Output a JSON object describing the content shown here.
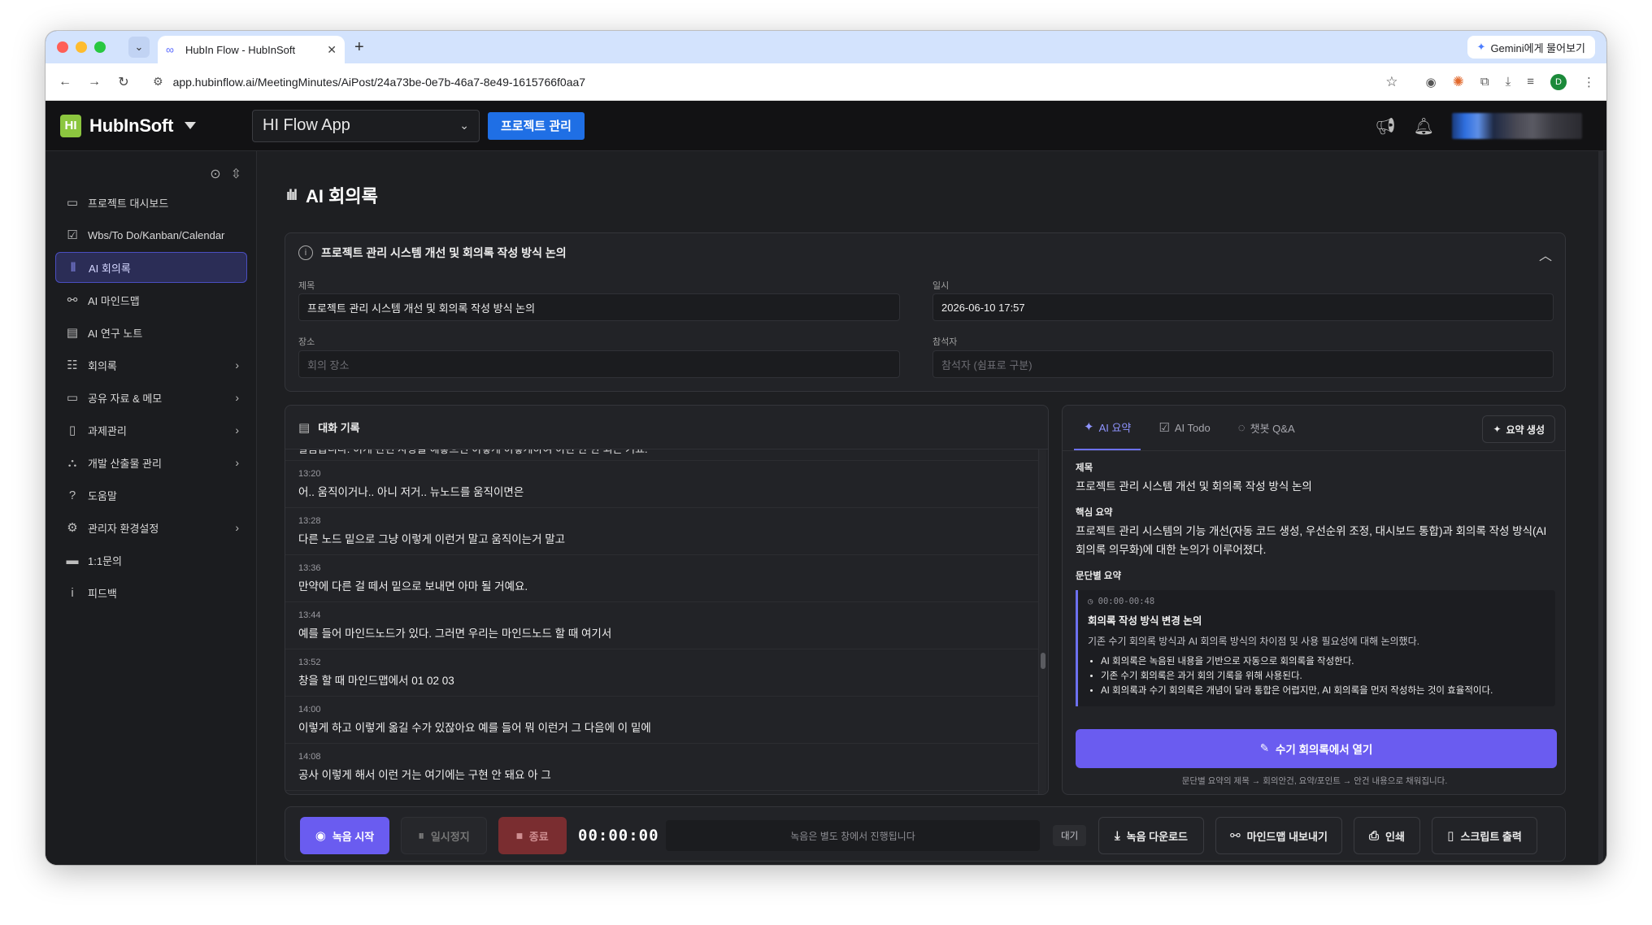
{
  "browser": {
    "tab_title": "HubIn Flow - HubInSoft",
    "gemini_label": "Gemini에게 물어보기",
    "url": "app.hubinflow.ai/MeetingMinutes/AiPost/24a73be-0e7b-46a7-8e49-1615766f0aa7",
    "profile_initial": "D"
  },
  "header": {
    "brand": "HubInSoft",
    "app_selector": "HI Flow App",
    "project_button": "프로젝트 관리"
  },
  "sidebar": {
    "items": [
      {
        "label": "프로젝트 대시보드",
        "icon": "dashboard-icon",
        "glyph": "▭",
        "has_arrow": false
      },
      {
        "label": "Wbs/To Do/Kanban/Calendar",
        "icon": "calendar-check-icon",
        "glyph": "☑",
        "has_arrow": false
      },
      {
        "label": "AI 회의록",
        "icon": "audio-wave-icon",
        "glyph": "⦀",
        "has_arrow": false,
        "active": true
      },
      {
        "label": "AI 마인드맵",
        "icon": "mindmap-icon",
        "glyph": "⚯",
        "has_arrow": false
      },
      {
        "label": "AI 연구 노트",
        "icon": "note-icon",
        "glyph": "▤",
        "has_arrow": false
      },
      {
        "label": "회의록",
        "icon": "chat-icon",
        "glyph": "☷",
        "has_arrow": true
      },
      {
        "label": "공유 자료 & 메모",
        "icon": "folder-icon",
        "glyph": "▭",
        "has_arrow": true
      },
      {
        "label": "과제관리",
        "icon": "task-icon",
        "glyph": "▯",
        "has_arrow": true
      },
      {
        "label": "개발 산출물 관리",
        "icon": "hierarchy-icon",
        "glyph": "⛬",
        "has_arrow": true
      },
      {
        "label": "도움말",
        "icon": "help-icon",
        "glyph": "?",
        "has_arrow": false
      },
      {
        "label": "관리자 환경설정",
        "icon": "admin-settings-icon",
        "glyph": "⚙",
        "has_arrow": true
      },
      {
        "label": "1:1문의",
        "icon": "message-icon",
        "glyph": "▬",
        "has_arrow": false
      },
      {
        "label": "피드백",
        "icon": "info-icon",
        "glyph": "i",
        "has_arrow": false
      }
    ]
  },
  "page": {
    "title": "AI 회의록"
  },
  "meeting": {
    "header": "프로젝트 관리 시스템 개선 및 회의록 작성 방식 논의",
    "title_label": "제목",
    "title_value": "프로젝트 관리 시스템 개선 및 회의록 작성 방식 논의",
    "date_label": "일시",
    "date_value": "2026-06-10 17:57",
    "place_label": "장소",
    "place_placeholder": "회의 장소",
    "attendee_label": "참석자",
    "attendee_placeholder": "참석자 (쉼표로 구분)"
  },
  "chat": {
    "title": "대화 기록",
    "partial_line": "말씀습니다. 이게 관련 사항들 해놓으면 이렇게 이렇게하여 이런 한 한 되는 거죠.",
    "lines": [
      {
        "time": "13:20",
        "text": "어.. 움직이거나.. 아니 저거.. 뉴노드를 움직이면은"
      },
      {
        "time": "13:28",
        "text": "다른 노드 밑으로 그냥 이렇게 이런거 말고 움직이는거 말고"
      },
      {
        "time": "13:36",
        "text": "만약에 다른 걸 떼서 밑으로 보내면 아마 될 거예요."
      },
      {
        "time": "13:44",
        "text": "예를 들어 마인드노드가 있다. 그러면 우리는 마인드노드 할 때 여기서"
      },
      {
        "time": "13:52",
        "text": "창을 할 때 마인드맵에서 01 02 03"
      },
      {
        "time": "14:00",
        "text": "이렇게 하고 이렇게 옮길 수가 있잖아요 예를 들어 뭐 이런거 그 다음에 이 밑에"
      },
      {
        "time": "14:08",
        "text": "공사 이렇게 해서 이런 거는 여기에는 구현 안 돼요 아 그"
      }
    ]
  },
  "ai_panel": {
    "tabs": [
      {
        "label": "AI 요약",
        "icon": "sparkle-icon",
        "glyph": "✦",
        "active": true
      },
      {
        "label": "AI Todo",
        "icon": "checkbox-icon",
        "glyph": "☑",
        "active": false
      },
      {
        "label": "챗봇 Q&A",
        "icon": "chat-bubble-icon",
        "glyph": "◌",
        "active": false
      }
    ],
    "generate_button": "요약 생성",
    "title_heading": "제목",
    "title_text": "프로젝트 관리 시스템 개선 및 회의록 작성 방식 논의",
    "core_heading": "핵심 요약",
    "core_text": "프로젝트 관리 시스템의 기능 개선(자동 코드 생성, 우선순위 조정, 대시보드 통합)과 회의록 작성 방식(AI 회의록 의무화)에 대한 논의가 이루어졌다.",
    "para_heading": "문단별 요약",
    "paragraph": {
      "time": "00:00-00:48",
      "title": "회의록 작성 방식 변경 논의",
      "desc": "기존 수기 회의록 방식과 AI 회의록 방식의 차이점 및 사용 필요성에 대해 논의했다.",
      "bullets": [
        "AI 회의록은 녹음된 내용을 기반으로 자동으로 회의록을 작성한다.",
        "기존 수기 회의록은 과거 회의 기록을 위해 사용된다.",
        "AI 회의록과 수기 회의록은 개념이 달라 통합은 어렵지만, AI 회의록을 먼저 작성하는 것이 효율적이다."
      ]
    },
    "open_button": "수기 회의록에서 열기",
    "open_note": "문단별 요약의 제목 → 회의안건, 요약/포인트 → 안건 내용으로 채워집니다."
  },
  "controls": {
    "record": "녹음 시작",
    "pause": "일시정지",
    "stop": "종료",
    "timer": "00:00:00",
    "note": "녹음은 별도 창에서 진행됩니다",
    "status": "대기",
    "download": "녹음 다운로드",
    "mindmap_export": "마인드맵 내보내기",
    "print": "인쇄",
    "script": "스크립트 출력"
  },
  "colors": {
    "accent": "#6a5cf0",
    "project_blue": "#1f6fe5",
    "brand_green": "#8cc63f"
  }
}
